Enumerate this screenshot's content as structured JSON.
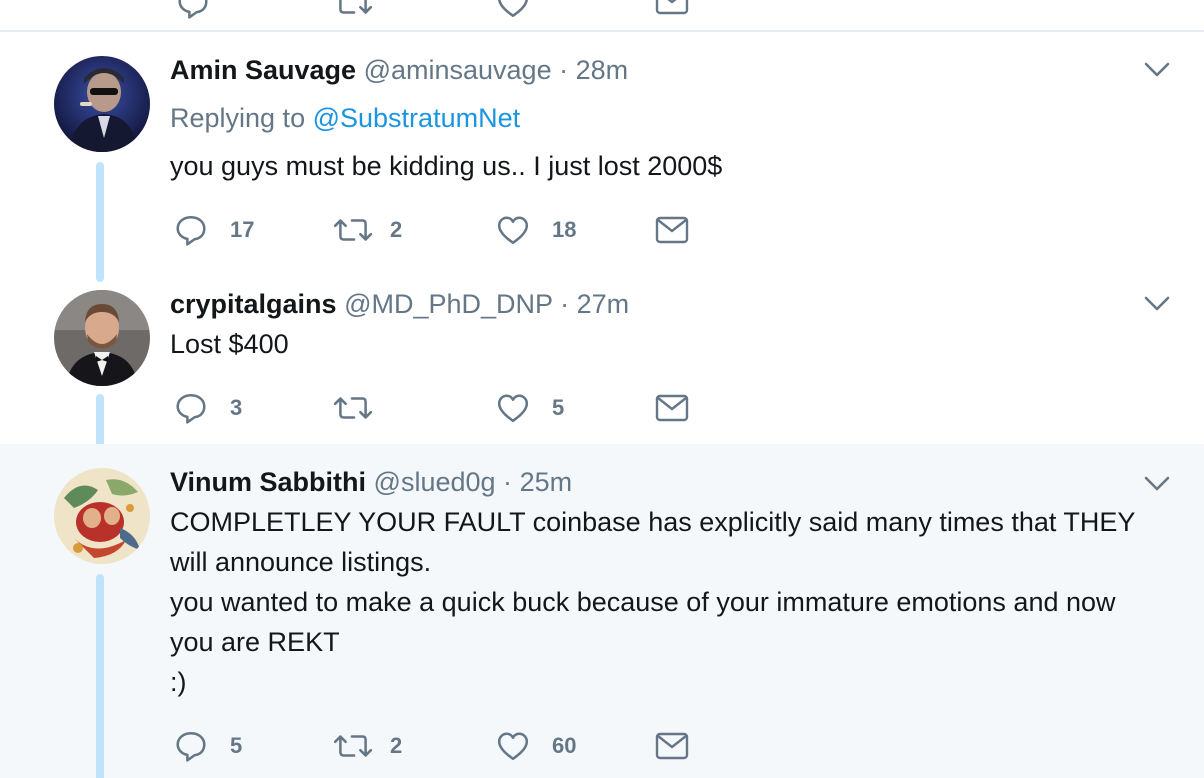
{
  "tweets": [
    {
      "name": "Amin Sauvage",
      "handle": "@aminsauvage",
      "separator": "·",
      "time": "28m",
      "replying_prefix": "Replying to",
      "replying_to": "@SubstratumNet",
      "text": [
        "you guys must be kidding us.. I just lost 2000$"
      ],
      "reply_count": "17",
      "retweet_count": "2",
      "like_count": "18",
      "highlighted": false
    },
    {
      "name": "crypitalgains",
      "handle": "@MD_PhD_DNP",
      "separator": "·",
      "time": "27m",
      "text": [
        "Lost $400"
      ],
      "reply_count": "3",
      "retweet_count": "",
      "like_count": "5",
      "highlighted": false
    },
    {
      "name": "Vinum Sabbithi",
      "handle": "@slued0g",
      "separator": "·",
      "time": "25m",
      "text": [
        "COMPLETLEY YOUR FAULT coinbase has explicitly said many times that THEY",
        "will announce listings.",
        "you wanted to make a quick buck because of your immature emotions and now",
        "you are REKT",
        ":)"
      ],
      "reply_count": "5",
      "retweet_count": "2",
      "like_count": "60",
      "highlighted": true
    }
  ],
  "icons": {
    "reply": "reply-icon",
    "retweet": "retweet-icon",
    "like": "heart-icon",
    "message": "envelope-icon",
    "more": "chevron-down-icon"
  },
  "colors": {
    "link": "#1b95e0",
    "muted": "#657786",
    "thread_line": "#bfe3fb",
    "highlight_bg": "#f5f8fa"
  }
}
